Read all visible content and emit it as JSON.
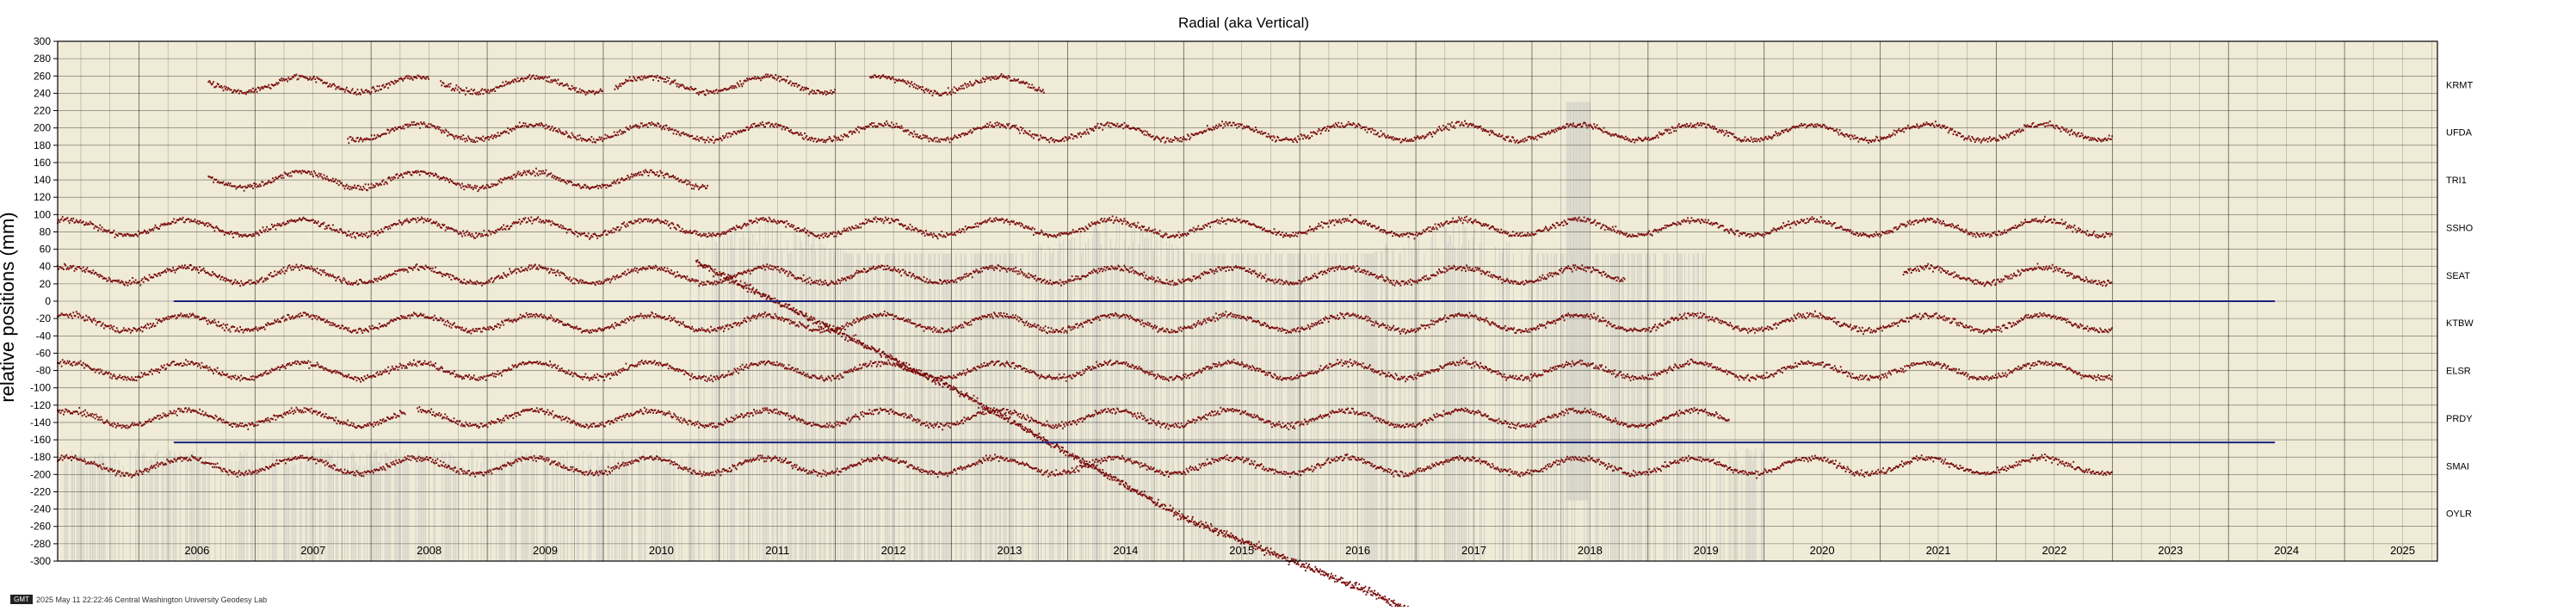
{
  "chart_data": {
    "type": "scatter",
    "title": "Radial (aka Vertical)",
    "ylabel": "relative positions (mm)",
    "xlabel": "",
    "xlim": [
      2005.3,
      2025.8
    ],
    "ylim": [
      -300,
      300
    ],
    "grid": true,
    "x_ticks": [
      2006,
      2007,
      2008,
      2009,
      2010,
      2011,
      2012,
      2013,
      2014,
      2015,
      2016,
      2017,
      2018,
      2019,
      2020,
      2021,
      2022,
      2023,
      2024,
      2025
    ],
    "y_ticks": [
      300,
      280,
      260,
      240,
      220,
      200,
      180,
      160,
      140,
      120,
      100,
      80,
      60,
      40,
      20,
      0,
      -20,
      -40,
      -60,
      -80,
      -100,
      -120,
      -140,
      -160,
      -180,
      -200,
      -220,
      -240,
      -260,
      -280,
      -300
    ],
    "colors": {
      "background": "#efebd7",
      "points": "#7a0c0c",
      "error_bars": "#bdbdbd",
      "reference_lines": "#1a237e",
      "grid": "#000000"
    },
    "series": [
      {
        "name": "KRMT",
        "offset": 250,
        "segments": [
          [
            2006.6,
            2008.5
          ],
          [
            2008.6,
            2010.0
          ],
          [
            2010.1,
            2012.0
          ],
          [
            2012.3,
            2013.8
          ]
        ]
      },
      {
        "name": "UFDA",
        "offset": 195,
        "segments": [
          [
            2007.8,
            2023.0
          ]
        ]
      },
      {
        "name": "TRI1",
        "offset": 140,
        "segments": [
          [
            2006.6,
            2010.1
          ],
          [
            2010.1,
            2010.9
          ]
        ]
      },
      {
        "name": "SSHO",
        "offset": 85,
        "segments": [
          [
            2005.3,
            2023.0
          ]
        ]
      },
      {
        "name": "SEAT",
        "offset": 30,
        "segments": [
          [
            2005.3,
            2018.8
          ],
          [
            2021.2,
            2023.0
          ]
        ]
      },
      {
        "name": "KTBW",
        "offset": -25,
        "segments": [
          [
            2005.3,
            2023.0
          ]
        ]
      },
      {
        "name": "ELSR",
        "offset": -80,
        "segments": [
          [
            2005.3,
            2023.0
          ]
        ]
      },
      {
        "name": "PRDY",
        "offset": -135,
        "segments": [
          [
            2005.3,
            2008.3
          ],
          [
            2008.4,
            2019.7
          ]
        ]
      },
      {
        "name": "SMAI",
        "offset": -190,
        "segments": [
          [
            2005.3,
            2023.0
          ]
        ]
      },
      {
        "name": "OYLR",
        "offset": -245,
        "segments": []
      }
    ],
    "drift_series": {
      "x": [
        2010.8,
        2013.0,
        2015.0,
        2016.5,
        2017.0
      ],
      "y": [
        45,
        -100,
        -250,
        -330,
        -360
      ]
    },
    "reference_lines": [
      {
        "y": 0,
        "x": [
          2006.3,
          2024.4
        ]
      },
      {
        "y": -163,
        "x": [
          2006.3,
          2024.4
        ]
      }
    ]
  },
  "footer": {
    "logo": "GMT",
    "text": "2025 May 11 22:22:46    Central Washington University Geodesy Lab"
  }
}
